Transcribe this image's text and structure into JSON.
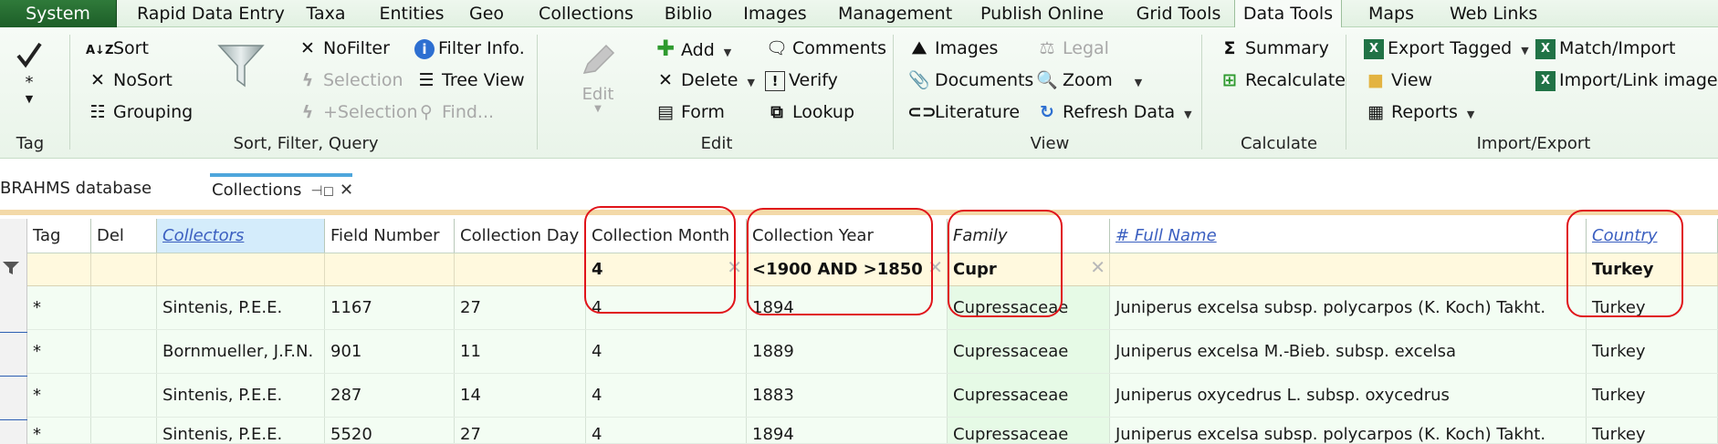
{
  "menu": {
    "tabs": [
      "System",
      "Rapid Data Entry",
      "Taxa",
      "Entities",
      "Geo",
      "Collections",
      "Biblio",
      "Images",
      "Management",
      "Publish Online",
      "Grid Tools",
      "Data Tools",
      "Maps",
      "Web Links"
    ],
    "active": "Data Tools"
  },
  "ribbon": {
    "tag": {
      "star": "*",
      "label": "Tag"
    },
    "sort_filter": {
      "sort": "Sort",
      "nosort": "NoSort",
      "grouping": "Grouping",
      "nofilter": "NoFilter",
      "selection": "Selection",
      "plus_selection": "+Selection",
      "filter_info": "Filter Info.",
      "tree_view": "Tree View",
      "find": "Find...",
      "label": "Sort, Filter, Query"
    },
    "edit": {
      "edit": "Edit",
      "add": "Add",
      "delete": "Delete",
      "form": "Form",
      "comments": "Comments",
      "verify": "Verify",
      "lookup": "Lookup",
      "label": "Edit"
    },
    "view": {
      "images": "Images",
      "documents": "Documents",
      "literature": "Literature",
      "legal": "Legal",
      "zoom": "Zoom",
      "refresh": "Refresh Data",
      "label": "View"
    },
    "calculate": {
      "summary": "Summary",
      "recalculate": "Recalculate",
      "label": "Calculate"
    },
    "import_export": {
      "export_tagged": "Export Tagged",
      "view": "View",
      "reports": "Reports",
      "match_import": "Match/Import",
      "import_link_images": "Import/Link images",
      "label": "Import/Export"
    }
  },
  "doc_tabs": [
    "BRAHMS database",
    "Collections"
  ],
  "grid": {
    "columns": [
      "Tag",
      "Del",
      "Collectors",
      "Field Number",
      "Collection Day",
      "Collection Month",
      "Collection Year",
      "Family",
      "# Full Name",
      "Country"
    ],
    "filters": {
      "collection_month": "4",
      "collection_year": "<1900 AND >1850",
      "family": "Cupr",
      "country": "Turkey"
    },
    "rows": [
      {
        "tag": "*",
        "collectors": "Sintenis, P.E.E.",
        "field_number": "1167",
        "day": "27",
        "month": "4",
        "year": "1894",
        "family": "Cupressaceae",
        "full_name": "Juniperus excelsa subsp. polycarpos (K. Koch) Takht.",
        "country": "Turkey"
      },
      {
        "tag": "*",
        "collectors": "Bornmueller, J.F.N.",
        "field_number": "901",
        "day": "11",
        "month": "4",
        "year": "1889",
        "family": "Cupressaceae",
        "full_name": "Juniperus excelsa M.-Bieb. subsp. excelsa",
        "country": "Turkey"
      },
      {
        "tag": "*",
        "collectors": "Sintenis, P.E.E.",
        "field_number": "287",
        "day": "14",
        "month": "4",
        "year": "1883",
        "family": "Cupressaceae",
        "full_name": "Juniperus oxycedrus L. subsp. oxycedrus",
        "country": "Turkey"
      },
      {
        "tag": "*",
        "collectors": "Sintenis, P.E.E.",
        "field_number": "5520",
        "day": "27",
        "month": "4",
        "year": "1894",
        "family": "Cupressaceae",
        "full_name": "Juniperus excelsa subsp. polycarpos (K. Koch) Takht.",
        "country": "Turkey"
      }
    ]
  },
  "colors": {
    "accent_green": "#1d5e28",
    "annotation_red": "#e0141a",
    "active_tab_blue": "#4ea6dc",
    "filter_row": "#fff9de"
  }
}
